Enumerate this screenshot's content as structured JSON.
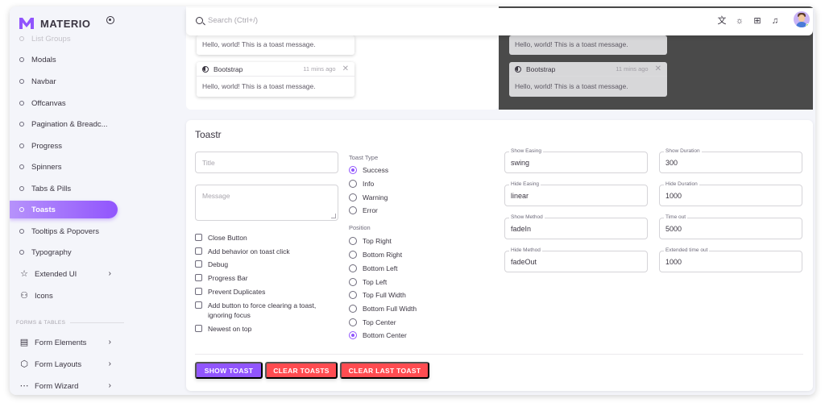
{
  "brand": {
    "name": "MATERIO",
    "accent": "#9155fd"
  },
  "sidebar": {
    "items": [
      {
        "label": "List Groups"
      },
      {
        "label": "Modals"
      },
      {
        "label": "Navbar"
      },
      {
        "label": "Offcanvas"
      },
      {
        "label": "Pagination & Breadc..."
      },
      {
        "label": "Progress"
      },
      {
        "label": "Spinners"
      },
      {
        "label": "Tabs & Pills"
      },
      {
        "label": "Toasts"
      },
      {
        "label": "Tooltips & Popovers"
      },
      {
        "label": "Typography"
      },
      {
        "label": "Extended UI",
        "icon": "star-icon"
      },
      {
        "label": "Icons",
        "icon": "shapes-icon"
      }
    ],
    "section": "FORMS & TABLES",
    "forms": [
      {
        "label": "Form Elements",
        "icon": "form-icon"
      },
      {
        "label": "Form Layouts",
        "icon": "cube-icon"
      },
      {
        "label": "Form Wizard",
        "icon": "dots-icon"
      }
    ]
  },
  "topbar": {
    "search_placeholder": "Search (Ctrl+/)"
  },
  "preview": {
    "toast_title": "Bootstrap",
    "toast_time": "11 mins ago",
    "toast_message": "Hello, world! This is a toast message."
  },
  "toastr": {
    "title": "Toastr",
    "title_placeholder": "Title",
    "message_placeholder": "Message",
    "checkboxes": [
      "Close Button",
      "Add behavior on toast click",
      "Debug",
      "Progress Bar",
      "Prevent Duplicates",
      "Add button to force clearing a toast, ignoring focus",
      "Newest on top"
    ],
    "toast_type_label": "Toast Type",
    "toast_types": [
      "Success",
      "Info",
      "Warning",
      "Error"
    ],
    "position_label": "Position",
    "positions": [
      "Top Right",
      "Bottom Right",
      "Bottom Left",
      "Top Left",
      "Top Full Width",
      "Bottom Full Width",
      "Top Center",
      "Bottom Center"
    ],
    "fields_left": [
      {
        "label": "Show Easing",
        "value": "swing"
      },
      {
        "label": "Hide Easing",
        "value": "linear"
      },
      {
        "label": "Show Method",
        "value": "fadeIn"
      },
      {
        "label": "Hide Method",
        "value": "fadeOut"
      }
    ],
    "fields_right": [
      {
        "label": "Show Duration",
        "value": "300"
      },
      {
        "label": "Hide Duration",
        "value": "1000"
      },
      {
        "label": "Time out",
        "value": "5000"
      },
      {
        "label": "Extended time out",
        "value": "1000"
      }
    ],
    "buttons": {
      "show": "SHOW TOAST",
      "clear": "CLEAR TOASTS",
      "clear_last": "CLEAR LAST TOAST"
    }
  }
}
